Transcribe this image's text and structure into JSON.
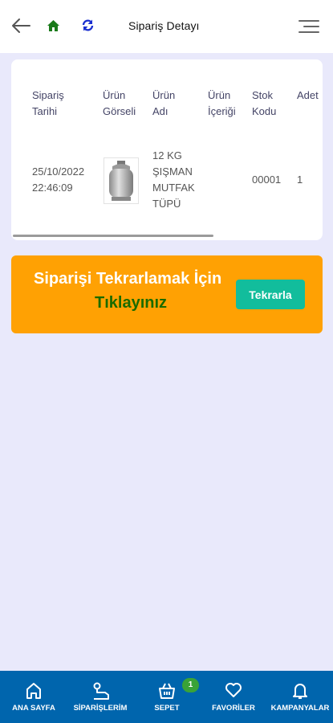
{
  "header": {
    "title": "Sipariş Detayı",
    "icons": [
      "back-arrow-icon",
      "home-icon",
      "refresh-icon",
      "menu-icon"
    ],
    "colors": {
      "home": "#1a7a1a",
      "refresh": "#1a2fd0"
    }
  },
  "order_table": {
    "columns": [
      {
        "line1": "Sipariş",
        "line2": "Tarihi"
      },
      {
        "line1": "Ürün",
        "line2": "Görseli"
      },
      {
        "line1": "Ürün",
        "line2": "Adı"
      },
      {
        "line1": "Ürün",
        "line2": "İçeriği"
      },
      {
        "line1": "Stok",
        "line2": "Kodu"
      },
      {
        "line1": "Adet",
        "line2": ""
      }
    ],
    "rows": [
      {
        "date": "25/10/2022",
        "time": "22:46:09",
        "product_image": "gas-cylinder",
        "name_lines": [
          "12 KG",
          "ŞIŞMAN",
          "MUTFAK",
          "TÜPÜ"
        ],
        "content": "",
        "stock_code": "00001",
        "quantity": "1"
      }
    ]
  },
  "reorder": {
    "line1": "Siparişi Tekrarlamak İçin",
    "line2": "Tıklayınız",
    "button_label": "Tekrarla",
    "colors": {
      "banner": "#ffa103",
      "button": "#12bd9c",
      "line2": "#1a6b00"
    }
  },
  "bottom_nav": {
    "items": [
      {
        "label": "ANA SAYFA",
        "icon": "home-outline-icon"
      },
      {
        "label": "SİPARİŞLERİM",
        "icon": "orders-icon"
      },
      {
        "label": "SEPET",
        "icon": "basket-icon"
      },
      {
        "label": "FAVORİLER",
        "icon": "heart-icon"
      },
      {
        "label": "KAMPANYALAR",
        "icon": "bell-icon"
      }
    ],
    "cart_count": "1",
    "colors": {
      "background": "#0065ad",
      "badge": "#3aa337"
    }
  }
}
